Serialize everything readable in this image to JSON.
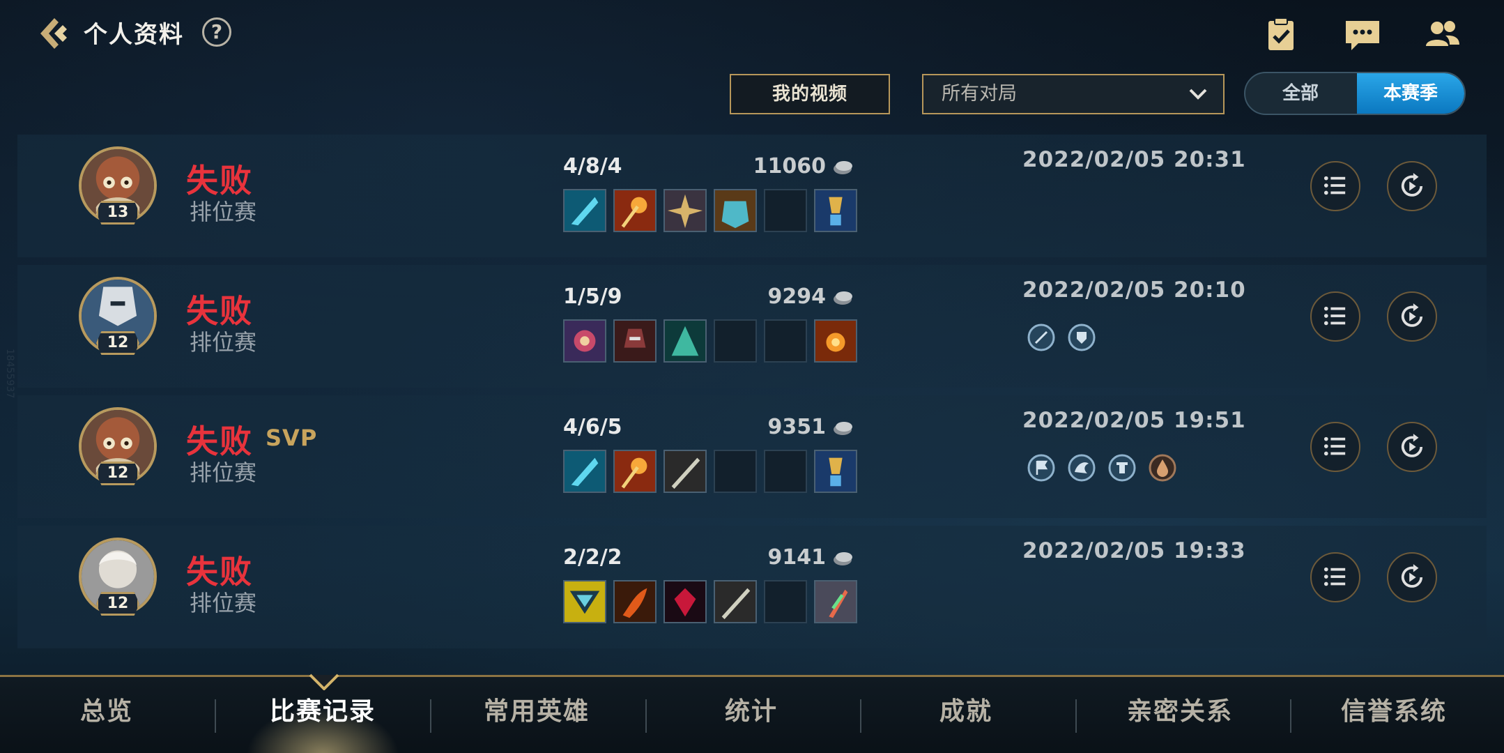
{
  "header": {
    "title": "个人资料",
    "help_label": "?"
  },
  "filters": {
    "my_video": "我的视频",
    "match_type": "所有对局",
    "season_all": "全部",
    "season_current": "本赛季"
  },
  "matches": [
    {
      "result": "失败",
      "svp": "",
      "mode": "排位赛",
      "level": "13",
      "kda": "4/8/4",
      "gold": "11060",
      "datetime": "2022/02/05 20:31"
    },
    {
      "result": "失败",
      "svp": "",
      "mode": "排位赛",
      "level": "12",
      "kda": "1/5/9",
      "gold": "9294",
      "datetime": "2022/02/05 20:10"
    },
    {
      "result": "失败",
      "svp": "SVP",
      "mode": "排位赛",
      "level": "12",
      "kda": "4/6/5",
      "gold": "9351",
      "datetime": "2022/02/05 19:51"
    },
    {
      "result": "失败",
      "svp": "",
      "mode": "排位赛",
      "level": "12",
      "kda": "2/2/2",
      "gold": "9141",
      "datetime": "2022/02/05 19:33"
    }
  ],
  "nav": {
    "tabs": [
      "总览",
      "比赛记录",
      "常用英雄",
      "统计",
      "成就",
      "亲密关系",
      "信誉系统"
    ],
    "active": "比赛记录"
  },
  "colors": {
    "loss": "#e8333c",
    "svp": "#c8a45d",
    "accent_blue": "#1890d8",
    "gold_border": "#b7975a"
  },
  "side_id": "18455937"
}
